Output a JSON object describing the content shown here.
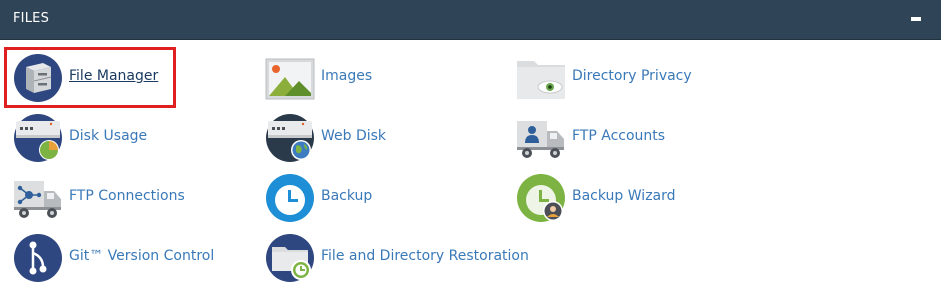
{
  "section": {
    "title": "FILES",
    "collapse_icon": "minus-icon"
  },
  "items": [
    {
      "label": "File Manager",
      "icon": "file-cabinet-icon",
      "active": true
    },
    {
      "label": "Images",
      "icon": "image-landscape-icon"
    },
    {
      "label": "Directory Privacy",
      "icon": "folder-eye-icon"
    },
    {
      "label": "Disk Usage",
      "icon": "server-pie-chart-icon"
    },
    {
      "label": "Web Disk",
      "icon": "server-globe-icon"
    },
    {
      "label": "FTP Accounts",
      "icon": "truck-user-icon"
    },
    {
      "label": "FTP Connections",
      "icon": "truck-network-icon"
    },
    {
      "label": "Backup",
      "icon": "backup-clock-icon"
    },
    {
      "label": "Backup Wizard",
      "icon": "backup-wizard-icon"
    },
    {
      "label": "Git™ Version Control",
      "icon": "git-branch-icon"
    },
    {
      "label": "File and Directory Restoration",
      "icon": "folder-clock-icon"
    }
  ],
  "colors": {
    "header_bg": "#2f4456",
    "link": "#3a79b8",
    "highlight": "#e02020"
  }
}
